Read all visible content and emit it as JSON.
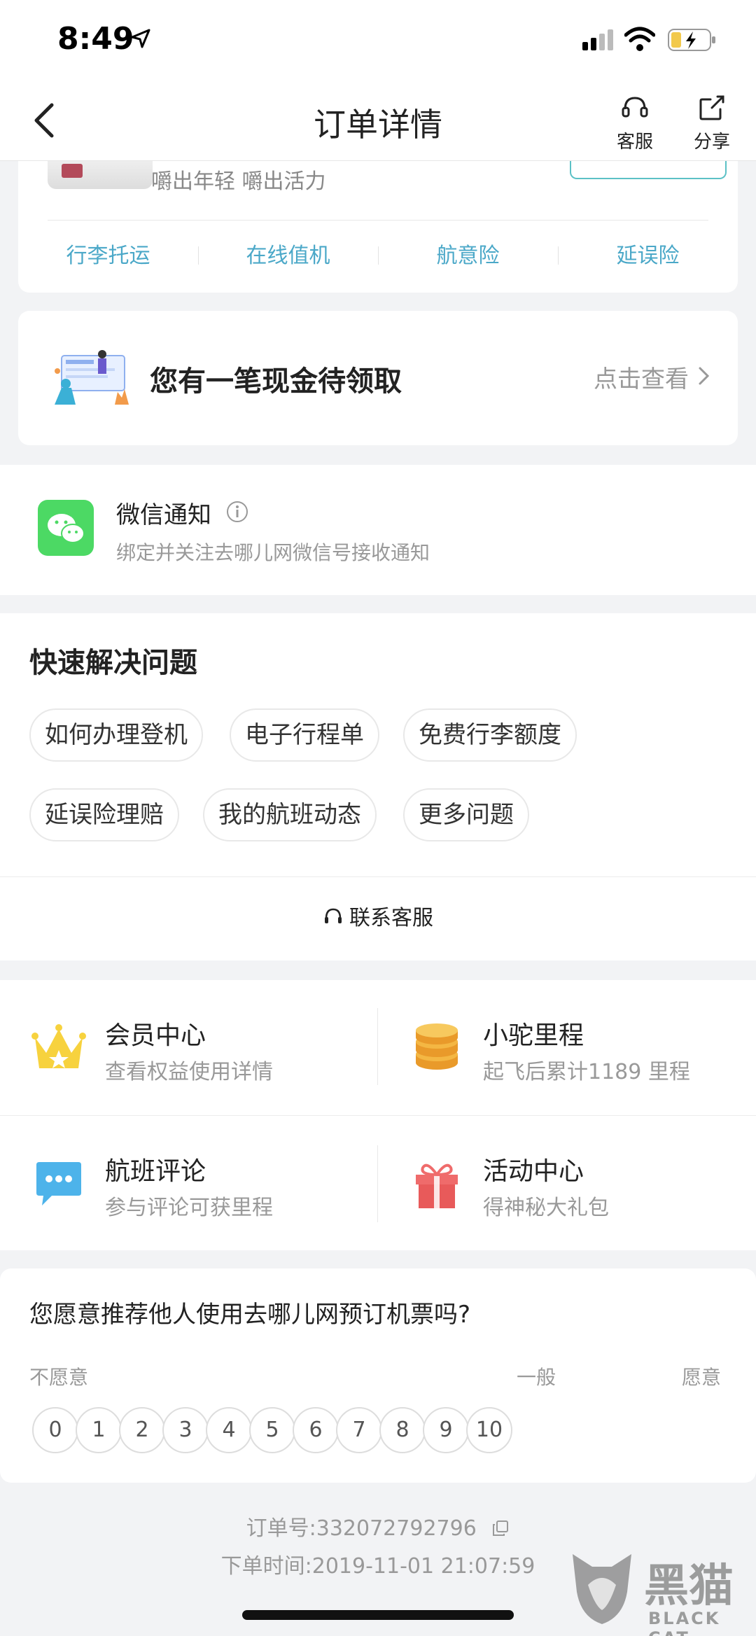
{
  "status_bar": {
    "time": "8:49"
  },
  "nav": {
    "title": "订单详情",
    "kefu_label": "客服",
    "share_label": "分享"
  },
  "promo": {
    "text": "嚼出年轻 嚼出活力"
  },
  "services": [
    "行李托运",
    "在线值机",
    "航意险",
    "延误险"
  ],
  "cash": {
    "title": "您有一笔现金待领取",
    "link": "点击查看"
  },
  "wechat": {
    "title": "微信通知",
    "subtitle": "绑定并关注去哪儿网微信号接收通知"
  },
  "quick": {
    "title": "快速解决问题",
    "chips": [
      "如何办理登机",
      "电子行程单",
      "免费行李额度",
      "延误险理赔",
      "我的航班动态",
      "更多问题"
    ],
    "contact": "联系客服"
  },
  "grid": [
    {
      "title": "会员中心",
      "subtitle": "查看权益使用详情",
      "icon": "crown-icon"
    },
    {
      "title": "小驼里程",
      "subtitle": "起飞后累计1189 里程",
      "icon": "coins-icon"
    },
    {
      "title": "航班评论",
      "subtitle": "参与评论可获里程",
      "icon": "comment-icon"
    },
    {
      "title": "活动中心",
      "subtitle": "得神秘大礼包",
      "icon": "gift-icon"
    }
  ],
  "nps": {
    "question": "您愿意推荐他人使用去哪儿网预订机票吗?",
    "low": "不愿意",
    "mid": "一般",
    "high": "愿意",
    "scores": [
      "0",
      "1",
      "2",
      "3",
      "4",
      "5",
      "6",
      "7",
      "8",
      "9",
      "10"
    ]
  },
  "order": {
    "number": "订单号:332072792796",
    "time": "下单时间:2019-11-01 21:07:59"
  },
  "watermark": {
    "cn": "黑猫",
    "en": "BLACK CAT"
  },
  "colors": {
    "accent": "#4ba8c8",
    "wechat_green": "#4cd964"
  }
}
